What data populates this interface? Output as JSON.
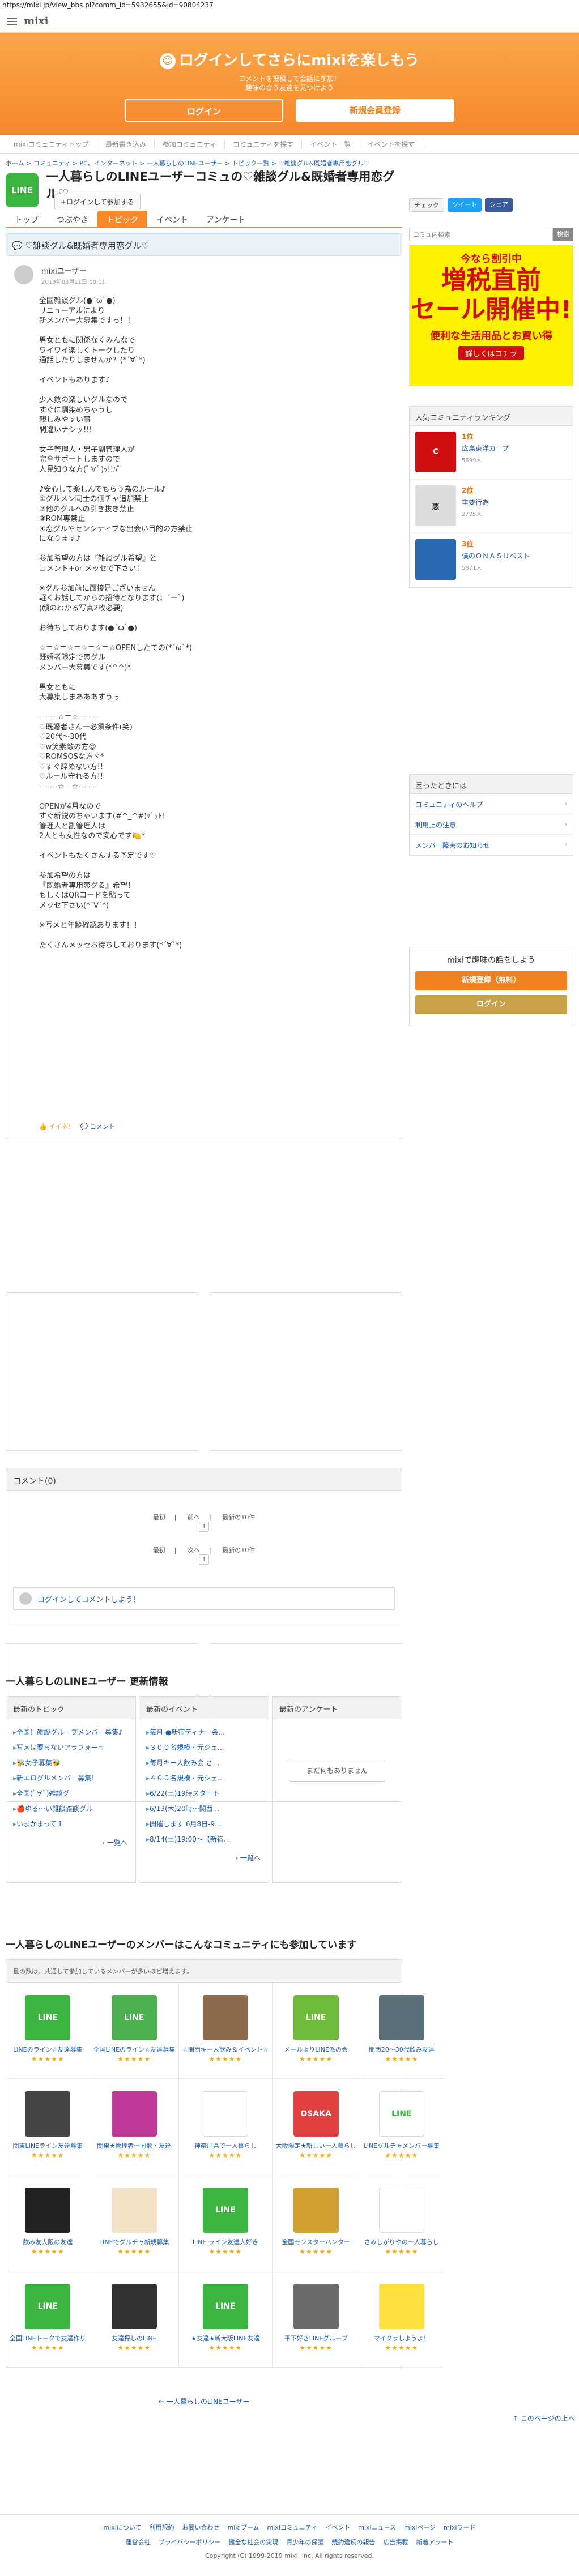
{
  "url": "https://mixi.jp/view_bbs.pl?comm_id=5932655&id=90804237",
  "header": {
    "logo": "mixi"
  },
  "banner": {
    "title": "ログインしてさらにmixiを楽しもう",
    "sub1": "コメントを投稿して会話に参加！",
    "sub2": "趣味の合う友達を見つけよう",
    "login": "ログイン",
    "register": "新規会員登録"
  },
  "gnav": [
    "mixiコミュニティトップ",
    "最新書き込み",
    "参加コミュニティ",
    "コミュニティを探す",
    "イベント一覧",
    "イベントを探す"
  ],
  "breadcrumb": "ホーム > コミュニティ > PC、インターネット > 一人暮らしのLINEユーザー > トピック一覧 > ♡雑談グル&既婚者専用恋グル♡",
  "community": {
    "logo_text": "LINE",
    "title": "一人暮らしのLINEユーザーコミュの♡雑談グル&既婚者専用恋グル♡",
    "join": "+ログインして参加する"
  },
  "share": {
    "check": "チェック",
    "tweet": "ツイート",
    "share": "シェア"
  },
  "tabs": [
    "トップ",
    "つぶやき",
    "トピック",
    "イベント",
    "アンケート"
  ],
  "search": {
    "placeholder": "コミュ内検索",
    "button": "検索"
  },
  "topic": {
    "title": "♡雑談グル&既婚者専用恋グル♡",
    "author": "mixiユーザー",
    "date": "2019年03月11日 00:11",
    "body": "全国雑談グル(●´ω`●)\nリニューアルにより\n新メンバー大募集ですっ！！\n\n男女ともに関係なくみんなで\nワイワイ楽しくトークしたり\n通話したりしませんか？(*´∀`*)\n\nイベントもあります♪\n\n少人数の楽しいグルなので\nすぐに馴染めちゃうし\n親しみやすい事\n間違いナシッ!!!\n\n女子管理人・男子副管理人が\n完全サポートしますので\n人見知りな方(ﾟ∀ﾟ)ｯ!!ﾊﾞ\n\n♪安心して楽しんでもらう為のルール♪\n①グルメン同士の個チャ追加禁止\n②他のグルへの引き抜き禁止\n③ROM専禁止\n④恋グルやセンシティブな出会い目的の方禁止\nになります♪\n\n参加希望の方は『雑談グル希望』と\nコメント+or メッセで下さい！\n\n※グル参加前に面接是ございません\n軽くお話してからの招待となります(；´ー`)\n(顔のわかる写真2枚必要)\n\nお待ちしております(●´ω`●)\n\n☆＝☆＝☆＝☆＝☆＝☆OPENしたての(*´ω`*)\n既婚者限定で恋グル\nメンバー大募集です(*^^)*\n\n男女ともに\n大募集しまあああすうぅ\n\n-------☆＝☆-------\n♡既婚者さん一必須条件(笑)\n♡20代〜30代\n♡w笑素敵の方😊\n♡ROMSOSな方ヾ*\n♡すぐ辞めない方!!\n♡ルール守れる方!!\n-------☆＝☆-------\n\nOPENが4月なので\nすぐ新鋭のちゃいます(#^_^#)ｹﾞｯﾄ!\n管理人と副管理人は\n2人とも女性なので安心です🍋*\n\nイベントもたくさんする予定です♡\n\n参加希望の方は\n『既婚者専用恋グる』希望！\nもしくはQRコードを貼って\nメッセ下さい(*´∀`*)\n\n※写メと年齢確認あります！！\n\nたくさんメッセお待ちしております(*´∀`*)",
    "iine": "イイネ！",
    "comment": "コメント"
  },
  "comments": {
    "title": "コメント(0)",
    "first": "最初",
    "prev": "前へ",
    "next": "次へ",
    "range": "最新の10件",
    "page": "1",
    "input_hint": "ログインしてコメントしよう！"
  },
  "updates": {
    "section_title": "一人暮らしのLINEユーザー 更新情報",
    "topics_head": "最新のトピック",
    "events_head": "最新のイベント",
    "surveys_head": "最新のアンケート",
    "topics": [
      "全国！雑談グル一プメンバー募集♪",
      "写メは要らないアラフォー☆",
      "🐝女子募集🐝",
      "新エログルメンバー募集！",
      "全国(ﾟ∀ﾟ)雑談グ",
      "🍎ゆる〜い雑談雑談グル",
      "いまかまって１"
    ],
    "events": [
      "毎月 ●新宿ディナー会...",
      "３００名規模・元シェ...",
      "毎月キー人飲み会 さ...",
      "４００名規模・元シェ...",
      "6/22(土)19時スタート",
      "6/13(木)20時〜関西...",
      "開催します 6月8日-9...",
      "8/14(土)19:00〜【新宿..."
    ],
    "more": "一覧へ",
    "surveys_empty": "まだ何もありません"
  },
  "members": {
    "section_title": "一人暮らしのLINEユーザーのメンバーはこんなコミュニティにも参加しています",
    "note": "星の数は、共通して参加しているメンバーが多いほど増えます。",
    "items": [
      {
        "name": "LINEのライン☆友達募集",
        "thumb": "LINE",
        "color": "#3bb53f",
        "stars": "★★★★★"
      },
      {
        "name": "全国LINEのライン☆友達募集",
        "thumb": "LINE",
        "color": "#4caf50",
        "stars": "★★★★★"
      },
      {
        "name": "☆関西キー人飲み＆イベント☆",
        "thumb": "",
        "color": "#8a6a4a",
        "stars": "★★★★★"
      },
      {
        "name": "メールよりLINE派の会",
        "thumb": "LINE",
        "color": "#6fba3a",
        "stars": "★★★★★"
      },
      {
        "name": "関西20〜30代飲み友達",
        "thumb": "",
        "color": "#5a6f7a",
        "stars": "★★★★★"
      },
      {
        "name": "関東LINEライン友達募集",
        "thumb": "",
        "color": "#444444",
        "stars": "★★★★★"
      },
      {
        "name": "関東★管理者一同飲・友達",
        "thumb": "",
        "color": "#c03a9a",
        "stars": "★★★★★"
      },
      {
        "name": "神奈川県で一人暮らし",
        "thumb": "",
        "color": "#ffffff",
        "stars": "★★★★★"
      },
      {
        "name": "大阪限定★新しい一人暮らし",
        "thumb": "OSAKA",
        "color": "#e04040",
        "stars": "★★★★★"
      },
      {
        "name": "LINEグルチャメンバー募集",
        "thumb": "LINE",
        "color": "#ffffff",
        "stars": "★★★★★"
      },
      {
        "name": "飲み友大阪の友達",
        "thumb": "",
        "color": "#222222",
        "stars": "★★★★★"
      },
      {
        "name": "LINEでグルチャ新規募集",
        "thumb": "",
        "color": "#f2e3c8",
        "stars": "★★★★★"
      },
      {
        "name": "LINE ライン友達大好き",
        "thumb": "LINE",
        "color": "#3bb53f",
        "stars": "★★★★★"
      },
      {
        "name": "全国モンスターハンター",
        "thumb": "",
        "color": "#d0a030",
        "stars": "★★★★★"
      },
      {
        "name": "さみしがりやの一人暮らし",
        "thumb": "",
        "color": "#ffffff",
        "stars": "★★★★★"
      },
      {
        "name": "全国LINEトークで友達作り",
        "thumb": "LINE",
        "color": "#3bb53f",
        "stars": "★★★★★"
      },
      {
        "name": "友達探しのLINE",
        "thumb": "",
        "color": "#333333",
        "stars": "★★★★★"
      },
      {
        "name": "★友達★新大阪LINE友達",
        "thumb": "LINE",
        "color": "#3bb53f",
        "stars": "★★★★★"
      },
      {
        "name": "平下好きLINEグループ",
        "thumb": "",
        "color": "#6b6b6b",
        "stars": "★★★★★"
      },
      {
        "name": "マイクラしようよ！",
        "thumb": "",
        "color": "#ffe040",
        "stars": "★★★★★"
      }
    ]
  },
  "links": {
    "back": "一人暮らしのLINEユーザー",
    "next": "このページの上へ"
  },
  "sidebar": {
    "ad": {
      "l1": "今なら割引中",
      "l2": "増税直前",
      "l3": "セール開催中!",
      "l4": "便利な生活用品とお買い得",
      "l5": "詳しくはコチラ"
    },
    "ranking_head": "人気コミュニティランキング",
    "ranking": [
      {
        "pos": "1位",
        "name": "広島東洋カープ",
        "count": "5699人",
        "color": "#d01010",
        "thumb": "C"
      },
      {
        "pos": "2位",
        "name": "重要行為",
        "count": "2725人",
        "color": "#dcdcdc",
        "thumb": "悪"
      },
      {
        "pos": "3位",
        "name": "僕のＯＮＡＳＵベスト",
        "count": "5871人",
        "color": "#2a6ab0",
        "thumb": ""
      }
    ],
    "help_head": "困ったときには",
    "help": [
      "コミュニティのヘルプ",
      "利用上の注意",
      "メンバー障害のお知らせ"
    ],
    "enjoy": {
      "title": "mixiで趣味の話をしよう",
      "register": "新規登録（無料）",
      "login": "ログイン"
    }
  },
  "footer": {
    "links": [
      "mixiについて",
      "利用規約",
      "お問い合わせ",
      "mixiブーム",
      "mixiコミュニティ",
      "イベント",
      "mixiニュース",
      "mixiページ",
      "mixiワード"
    ],
    "links2": [
      "運営会社",
      "プライバシーポリシー",
      "健全な社会の実現",
      "青少年の保護",
      "規約違反の報告",
      "広告掲載",
      "新着アラート"
    ],
    "copy": "Copyright (C) 1999-2019 mixi, Inc. All rights reserved."
  }
}
